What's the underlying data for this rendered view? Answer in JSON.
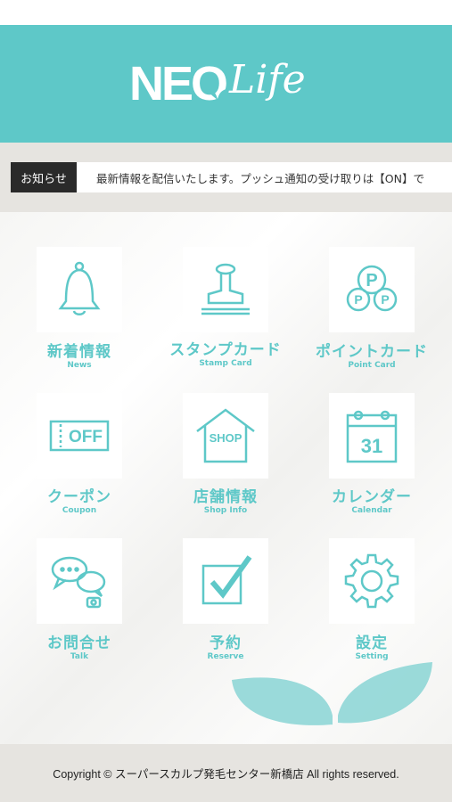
{
  "header": {
    "logo_text_main": "NEO",
    "logo_text_sub": "Life",
    "brand_color": "#5ec8c8"
  },
  "news": {
    "label": "お知らせ",
    "ticker": "最新情報を配信いたします。プッシュ通知の受け取りは【ON】で"
  },
  "menu": [
    {
      "jp": "新着情報",
      "en": "News",
      "icon": "bell-icon"
    },
    {
      "jp": "スタンプカード",
      "en": "Stamp Card",
      "icon": "stamp-icon"
    },
    {
      "jp": "ポイントカード",
      "en": "Point Card",
      "icon": "points-icon"
    },
    {
      "jp": "クーポン",
      "en": "Coupon",
      "icon": "coupon-icon",
      "icon_text": "OFF"
    },
    {
      "jp": "店舗情報",
      "en": "Shop Info",
      "icon": "shop-icon",
      "icon_text": "SHOP"
    },
    {
      "jp": "カレンダー",
      "en": "Calendar",
      "icon": "calendar-icon",
      "icon_text": "31"
    },
    {
      "jp": "お問合せ",
      "en": "Talk",
      "icon": "chat-icon"
    },
    {
      "jp": "予約",
      "en": "Reserve",
      "icon": "checkbox-icon"
    },
    {
      "jp": "設定",
      "en": "Setting",
      "icon": "gear-icon"
    }
  ],
  "footer": {
    "copyright": "Copyright © スーパースカルプ発毛センター新橋店 All rights reserved."
  }
}
